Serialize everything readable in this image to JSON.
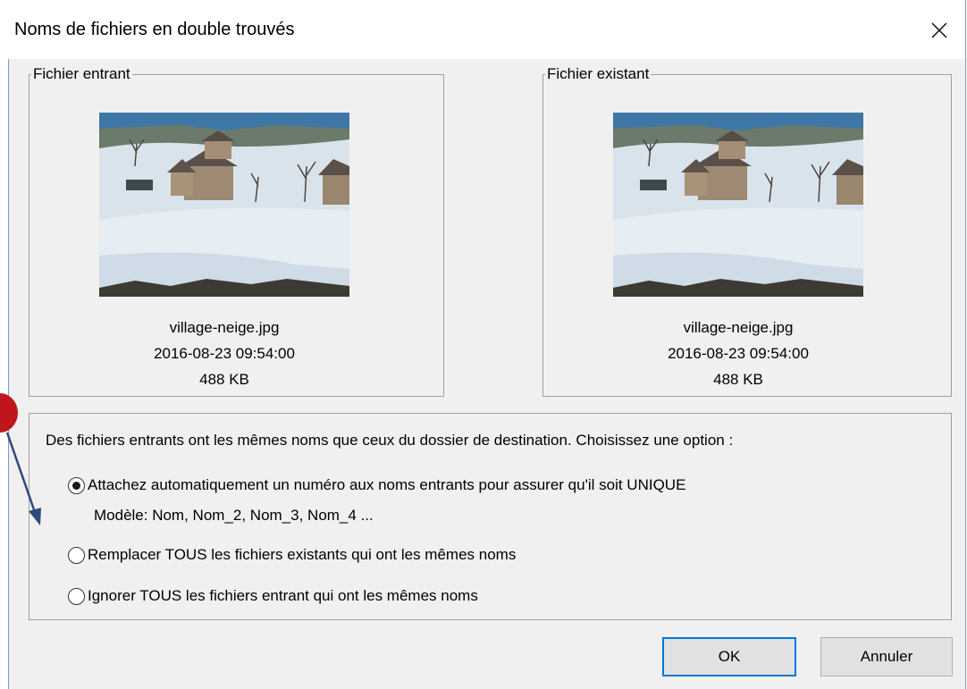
{
  "window": {
    "title": "Noms de fichiers en double trouvés"
  },
  "incoming": {
    "label": "Fichier entrant",
    "filename": "village-neige.jpg",
    "datetime": "2016-08-23 09:54:00",
    "size": "488 KB"
  },
  "existing": {
    "label": "Fichier existant",
    "filename": "village-neige.jpg",
    "datetime": "2016-08-23 09:54:00",
    "size": "488 KB"
  },
  "options": {
    "prompt": "Des fichiers entrants ont les mêmes noms que ceux du dossier de destination. Choisissez une option :",
    "items": [
      {
        "label": "Attachez automatiquement un numéro aux noms entrants pour assurer qu'il soit UNIQUE",
        "checked": true
      },
      {
        "label": "Remplacer TOUS les fichiers existants qui ont les mêmes noms",
        "checked": false
      },
      {
        "label": "Ignorer TOUS les fichiers entrant qui ont les mêmes noms",
        "checked": false
      }
    ],
    "model_hint": "Modèle: Nom, Nom_2, Nom_3, Nom_4 ..."
  },
  "buttons": {
    "ok": "OK",
    "cancel": "Annuler"
  },
  "colors": {
    "dialog_bg": "#f0f0f0",
    "default_button_border": "#0078d7",
    "annotation_marker": "#c0161b",
    "annotation_arrow": "#2e4a7a"
  },
  "icons": {
    "close": "close-icon",
    "annotation_arrow": "arrow-icon"
  }
}
